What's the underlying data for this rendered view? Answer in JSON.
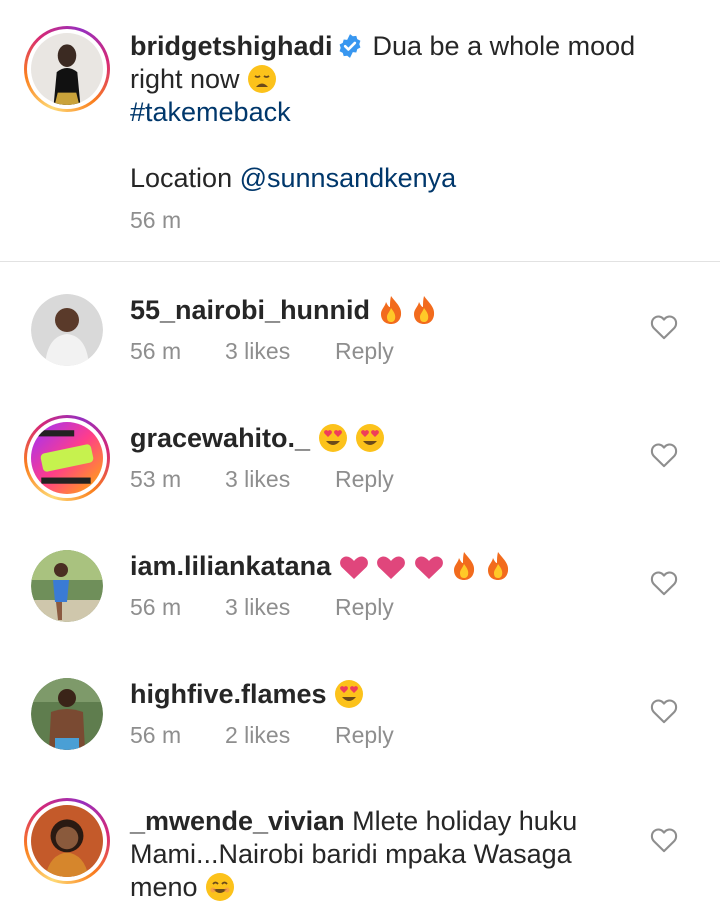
{
  "post": {
    "username": "bridgetshighadi",
    "caption_line1": "Dua be a whole mood",
    "caption_line2": "right now",
    "hashtag": "#takemeback",
    "location_label": "Location",
    "location_mention": "@sunnsandkenya",
    "time": "56 m",
    "verified": true
  },
  "comments": [
    {
      "username": "55_nairobi_hunnid",
      "text": "",
      "emojis": [
        "fire",
        "fire"
      ],
      "time": "56 m",
      "likes": "3 likes",
      "reply": "Reply",
      "story_ring": false
    },
    {
      "username": "gracewahito._",
      "text": "",
      "emojis": [
        "heart-eyes",
        "heart-eyes"
      ],
      "time": "53 m",
      "likes": "3 likes",
      "reply": "Reply",
      "story_ring": true
    },
    {
      "username": "iam.liliankatana",
      "text": "",
      "emojis": [
        "pink-heart",
        "pink-heart",
        "pink-heart",
        "fire",
        "fire"
      ],
      "time": "56 m",
      "likes": "3 likes",
      "reply": "Reply",
      "story_ring": false
    },
    {
      "username": "highfive.flames",
      "text": "",
      "emojis": [
        "heart-eyes"
      ],
      "time": "56 m",
      "likes": "2 likes",
      "reply": "Reply",
      "story_ring": false
    },
    {
      "username": "_mwende_vivian",
      "text_line1": "Mlete holiday huku",
      "text_line2": "Mami...Nairobi baridi mpaka Wasaga",
      "text_line3": "meno",
      "emojis": [
        "smile"
      ],
      "story_ring": true
    }
  ],
  "colors": {
    "link": "#00376b",
    "meta": "#8e8e8e",
    "verified": "#3897f0",
    "pink_heart": "#e0467c",
    "fire": "#f26b1d"
  }
}
